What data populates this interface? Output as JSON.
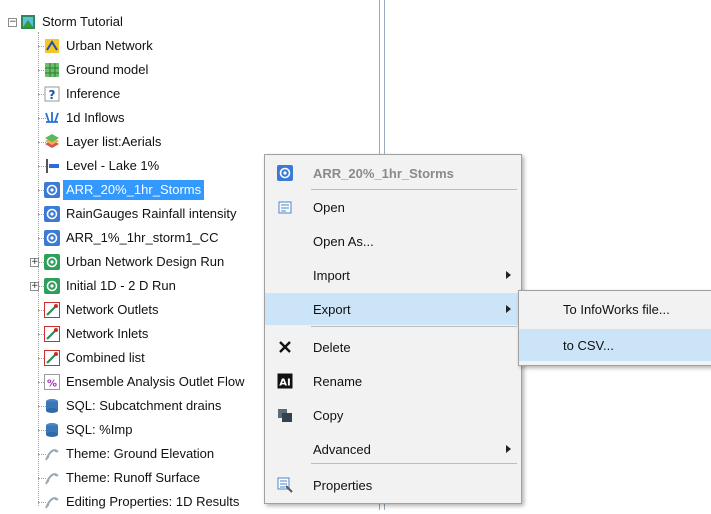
{
  "tree": {
    "root": {
      "label": "Storm Tutorial",
      "icon": "storm-tutorial-icon"
    },
    "items": [
      {
        "label": "Urban Network",
        "icon": "urban-network-icon"
      },
      {
        "label": "Ground model",
        "icon": "ground-model-icon"
      },
      {
        "label": "Inference",
        "icon": "inference-icon"
      },
      {
        "label": "1d Inflows",
        "icon": "inflows-icon"
      },
      {
        "label": "Layer list:Aerials",
        "icon": "layer-list-icon"
      },
      {
        "label": "Level - Lake 1%",
        "icon": "level-icon"
      },
      {
        "label": "ARR_20%_1hr_Storms",
        "icon": "rainfall-event-icon",
        "selected": true
      },
      {
        "label": "RainGauges Rainfall intensity",
        "icon": "rainfall-event-icon"
      },
      {
        "label": "ARR_1%_1hr_storm1_CC",
        "icon": "rainfall-event-icon"
      },
      {
        "label": "Urban Network Design Run",
        "icon": "run-group-icon",
        "expandable": true
      },
      {
        "label": "Initial 1D - 2 D Run",
        "icon": "run-group-icon",
        "expandable": true
      },
      {
        "label": "Network Outlets",
        "icon": "selection-list-icon"
      },
      {
        "label": "Network Inlets",
        "icon": "selection-list-icon"
      },
      {
        "label": "Combined list",
        "icon": "selection-list-icon"
      },
      {
        "label": "Ensemble Analysis Outlet Flow",
        "icon": "percent-icon"
      },
      {
        "label": "SQL: Subcatchment drains",
        "icon": "sql-icon"
      },
      {
        "label": "SQL: %Imp",
        "icon": "sql-icon"
      },
      {
        "label": "Theme: Ground Elevation",
        "icon": "theme-icon"
      },
      {
        "label": "Theme: Runoff Surface",
        "icon": "theme-icon"
      },
      {
        "label": "Editing Properties: 1D Results",
        "icon": "theme-icon"
      }
    ]
  },
  "context_menu": {
    "header": "ARR_20%_1hr_Storms",
    "items": [
      {
        "label": "Open",
        "icon": "open-icon"
      },
      {
        "label": "Open As...",
        "icon": ""
      },
      {
        "label": "Import",
        "icon": "",
        "submenu": true
      },
      {
        "label": "Export",
        "icon": "",
        "submenu": true,
        "highlighted": true
      },
      {
        "label": "Delete",
        "icon": "delete-icon"
      },
      {
        "label": "Rename",
        "icon": "rename-icon"
      },
      {
        "label": "Copy",
        "icon": "copy-icon"
      },
      {
        "label": "Advanced",
        "icon": "",
        "submenu": true
      },
      {
        "label": "Properties",
        "icon": "properties-icon"
      }
    ]
  },
  "submenu": {
    "items": [
      {
        "label": "To InfoWorks file..."
      },
      {
        "label": "to CSV...",
        "highlighted": true
      }
    ]
  },
  "colors": {
    "selection": "#3399ff",
    "menu_highlight": "#cce4f7",
    "menu_background": "#f2f2f2"
  }
}
